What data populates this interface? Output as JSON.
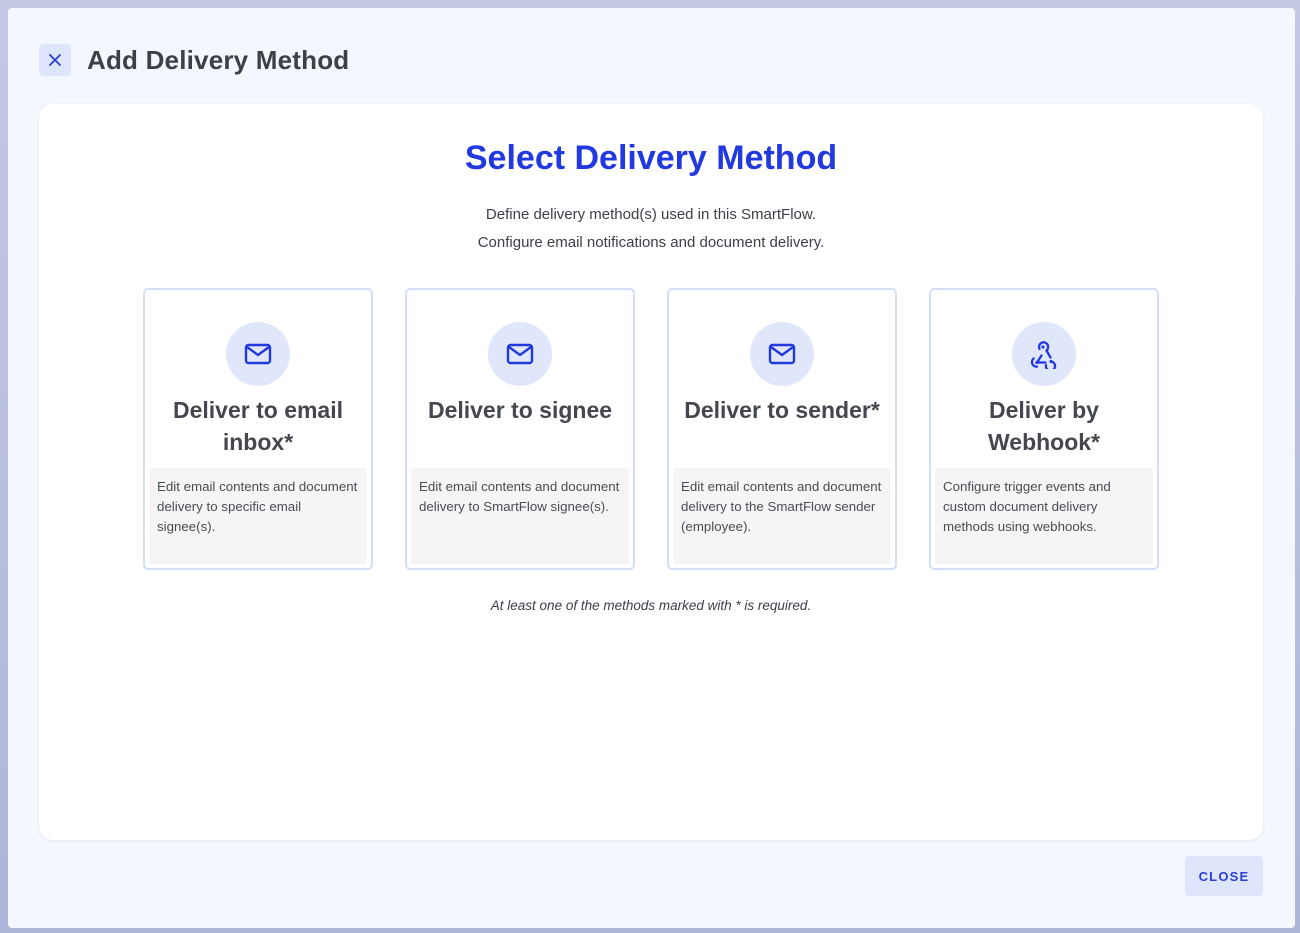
{
  "dialog": {
    "title": "Add Delivery Method",
    "close_icon": "close-icon",
    "close_button_label": "CLOSE"
  },
  "panel": {
    "heading": "Select Delivery Method",
    "subtitle_line1": "Define delivery method(s) used in this SmartFlow.",
    "subtitle_line2": "Configure email notifications and document delivery.",
    "footnote": "At least one of the methods marked with * is required."
  },
  "methods": [
    {
      "title": "Deliver to email inbox*",
      "icon": "envelope-icon",
      "description": "Edit email contents and document delivery to specific email signee(s)."
    },
    {
      "title": "Deliver to signee",
      "icon": "envelope-icon",
      "description": "Edit email contents and document delivery to SmartFlow signee(s)."
    },
    {
      "title": "Deliver to sender*",
      "icon": "envelope-icon",
      "description": "Edit email contents and document delivery to the SmartFlow sender (employee)."
    },
    {
      "title": "Deliver by Webhook*",
      "icon": "webhook-icon",
      "description": "Configure trigger events and custom document delivery methods using webhooks."
    }
  ],
  "colors": {
    "accent": "#2339e0",
    "dialog_bg": "#f4f7fd",
    "button_bg": "#dfe5fa",
    "card_border": "#d6def7",
    "icon_circle_bg": "#e1e7fb"
  }
}
